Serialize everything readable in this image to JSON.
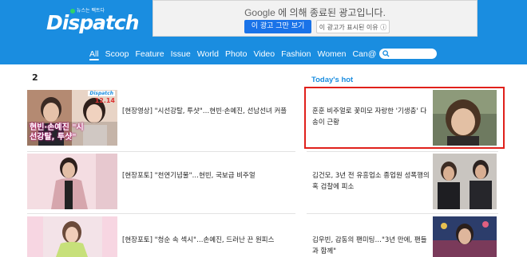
{
  "header": {
    "logo_tag": "뉴스는 팩트다",
    "logo_text": "Dispatch",
    "ad_google": "Google",
    "ad_message": "에 의해 종료된 광고입니다.",
    "ad_stop_button": "이 광고 그만 보기",
    "ad_why_button": "이 광고가 표시된 이유 ⓘ"
  },
  "nav": {
    "items": [
      "All",
      "Scoop",
      "Feature",
      "Issue",
      "World",
      "Photo",
      "Video",
      "Fashion",
      "Women",
      "Can@"
    ]
  },
  "page_number": "2",
  "todays_hot_title": "Today's hot",
  "articles": [
    {
      "title": "[현장영상] \"시선강탈, 투샷\"…현빈·손예진, 선남선녀 커플",
      "thumb_caption": "현빈·손예진 \"시선강탈, 투샷\"",
      "thumb_logo": "Dispatch",
      "thumb_date": "12.14"
    },
    {
      "title": "[현장포토] \"천연기념물\"…현빈, 국보급 비주얼"
    },
    {
      "title": "[현장포토] \"청순 속 섹시\"…손예진, 드러난 끈 원피스"
    }
  ],
  "hot_items": [
    {
      "title": "훈훈 비주얼로 꽃미모 자랑한 '기생충' 다송이 근황"
    },
    {
      "title": "김건모, 3년 전 유흥업소 종업원 성폭행의혹 검찰에 피소"
    },
    {
      "title": "김우빈, 감동의 팬미팅…\"3년 만에, 팬들과 함께\""
    }
  ],
  "colors": {
    "brand_blue": "#1a8de0",
    "highlight_red": "#e0201b",
    "ad_button_blue": "#1a73e8"
  }
}
